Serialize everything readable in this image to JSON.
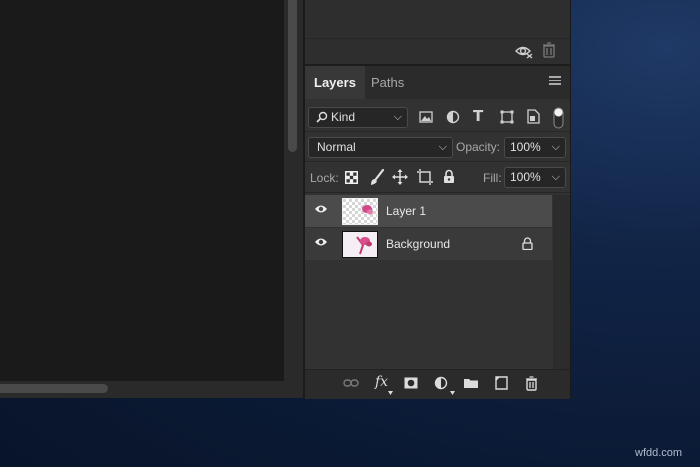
{
  "panel": {
    "tabs": [
      {
        "label": "Layers",
        "active": true
      },
      {
        "label": "Paths",
        "active": false
      }
    ],
    "filter": {
      "selected": "Kind"
    },
    "blend_mode": "Normal",
    "opacity": {
      "label": "Opacity:",
      "value": "100%"
    },
    "lock": {
      "label": "Lock:"
    },
    "fill": {
      "label": "Fill:",
      "value": "100%"
    },
    "layers": [
      {
        "name": "Layer 1",
        "selected": true,
        "visible": true,
        "locked": false
      },
      {
        "name": "Background",
        "selected": false,
        "visible": true,
        "locked": true
      }
    ]
  },
  "watermark": "wfdd.com",
  "colors": {
    "panel_bg": "#323232",
    "selected_row": "#4b4b4b",
    "canvas_bg": "#1a1a1a",
    "desktop": "#0b1a35"
  }
}
